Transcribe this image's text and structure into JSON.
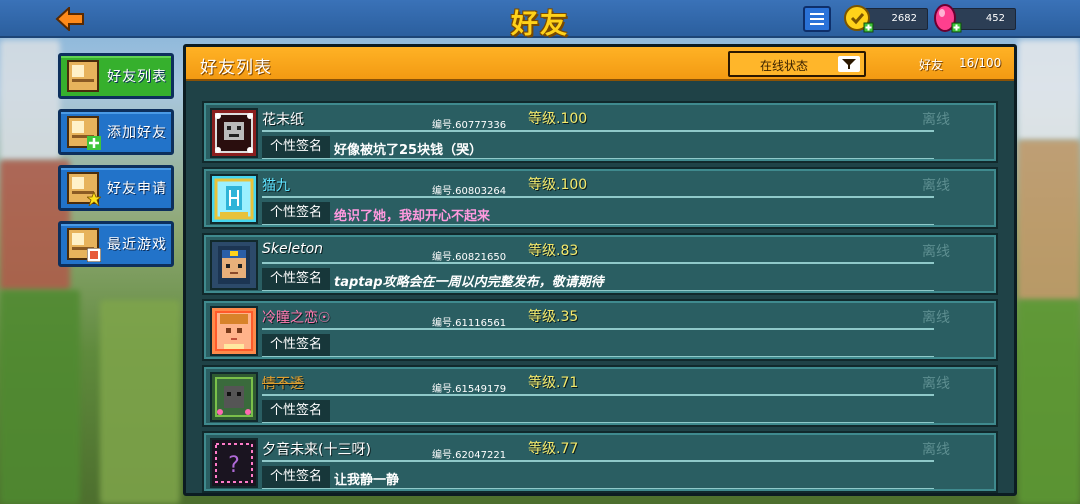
{
  "header": {
    "title": "好友",
    "coins": "2682",
    "gems": "452"
  },
  "sidebar": {
    "items": [
      {
        "label": "好友列表",
        "active": true
      },
      {
        "label": "添加好友",
        "active": false
      },
      {
        "label": "好友申请",
        "active": false
      },
      {
        "label": "最近游戏",
        "active": false
      }
    ]
  },
  "panel": {
    "title": "好友列表",
    "filter_label": "在线状态",
    "count_label": "好友",
    "count_value": "16/100"
  },
  "friends": [
    {
      "name": "花末纸",
      "id": "编号.60777336",
      "level": "等级.100",
      "status": "离线",
      "sig_label": "个性签名",
      "signature": "好像被坑了25块钱（哭）"
    },
    {
      "name": "猫九",
      "id": "编号.60803264",
      "level": "等级.100",
      "status": "离线",
      "sig_label": "个性签名",
      "signature": "绝识了她，我却开心不起来"
    },
    {
      "name": "Skeleton",
      "id": "编号.60821650",
      "level": "等级.83",
      "status": "离线",
      "sig_label": "个性签名",
      "signature": "taptap攻略会在一周以内完整发布，敬请期待"
    },
    {
      "name": "冷瞳之恋☉",
      "id": "编号.61116561",
      "level": "等级.35",
      "status": "离线",
      "sig_label": "个性签名",
      "signature": ""
    },
    {
      "name": "情不透",
      "id": "编号.61549179",
      "level": "等级.71",
      "status": "离线",
      "sig_label": "个性签名",
      "signature": ""
    },
    {
      "name": "夕音未来(十三呀)",
      "id": "编号.62047221",
      "level": "等级.77",
      "status": "离线",
      "sig_label": "个性签名",
      "signature": "让我静一静"
    }
  ],
  "colors": {
    "name_1_accent": "#ff6b8a",
    "name_2": "#5fe3ff",
    "name_4": "#ff7ab0",
    "name_5": "#e0a030",
    "sig_1": "#ffffff",
    "sig_2": "#ff9adf",
    "sig_3": "#ffffff",
    "sig_6": "#ffffff"
  }
}
